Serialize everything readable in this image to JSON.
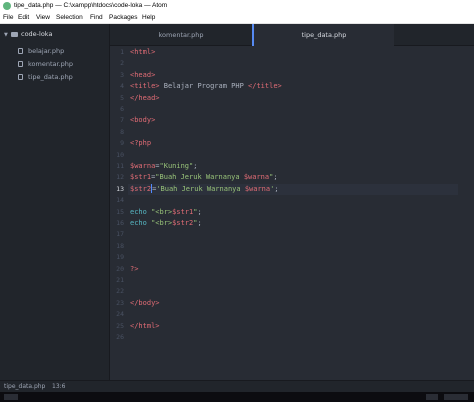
{
  "window": {
    "title": "tipe_data.php — C:\\xampp\\htdocs\\code-loka — Atom"
  },
  "menu": [
    "File",
    "Edit",
    "View",
    "Selection",
    "Find",
    "Packages",
    "Help"
  ],
  "sidebar": {
    "root": "code-loka",
    "files": [
      "belajar.php",
      "komentar.php",
      "tipe_data.php"
    ]
  },
  "tabs": [
    {
      "label": "komentar.php",
      "active": false
    },
    {
      "label": "tipe_data.php",
      "active": true
    }
  ],
  "editor": {
    "current_line": 13,
    "lines": [
      {
        "n": "1",
        "tokens": [
          {
            "t": "<html>",
            "c": "tag"
          }
        ]
      },
      {
        "n": "2",
        "tokens": []
      },
      {
        "n": "3",
        "tokens": [
          {
            "t": "<head>",
            "c": "tag"
          }
        ]
      },
      {
        "n": "4",
        "tokens": [
          {
            "t": "<title>",
            "c": "tag"
          },
          {
            "t": " Belajar Program PHP ",
            "c": "txt"
          },
          {
            "t": "</title>",
            "c": "tag"
          }
        ]
      },
      {
        "n": "5",
        "tokens": [
          {
            "t": "</head>",
            "c": "tag"
          }
        ]
      },
      {
        "n": "6",
        "tokens": []
      },
      {
        "n": "7",
        "tokens": [
          {
            "t": "<body>",
            "c": "tag"
          }
        ]
      },
      {
        "n": "8",
        "tokens": []
      },
      {
        "n": "9",
        "tokens": [
          {
            "t": "<?php",
            "c": "php"
          }
        ]
      },
      {
        "n": "10",
        "tokens": []
      },
      {
        "n": "11",
        "tokens": [
          {
            "t": "$warna",
            "c": "var"
          },
          {
            "t": "=",
            "c": "txt"
          },
          {
            "t": "\"Kuning\"",
            "c": "str"
          },
          {
            "t": ";",
            "c": "txt"
          }
        ]
      },
      {
        "n": "12",
        "tokens": [
          {
            "t": "$str1",
            "c": "var"
          },
          {
            "t": "=",
            "c": "txt"
          },
          {
            "t": "\"Buah Jeruk Warnanya ",
            "c": "str"
          },
          {
            "t": "$warna",
            "c": "var"
          },
          {
            "t": "\"",
            "c": "str"
          },
          {
            "t": ";",
            "c": "txt"
          }
        ]
      },
      {
        "n": "13",
        "tokens": [
          {
            "t": "$str2",
            "c": "var"
          },
          {
            "t": "=",
            "c": "cursor"
          },
          {
            "t": "'Buah Jeruk Warnanya ",
            "c": "str"
          },
          {
            "t": "$warna",
            "c": "var"
          },
          {
            "t": "'",
            "c": "str"
          },
          {
            "t": ";",
            "c": "txt"
          }
        ]
      },
      {
        "n": "14",
        "tokens": []
      },
      {
        "n": "15",
        "tokens": [
          {
            "t": "echo ",
            "c": "kw"
          },
          {
            "t": "\"<br>",
            "c": "str"
          },
          {
            "t": "$str1",
            "c": "var"
          },
          {
            "t": "\"",
            "c": "str"
          },
          {
            "t": ";",
            "c": "txt"
          }
        ]
      },
      {
        "n": "16",
        "tokens": [
          {
            "t": "echo ",
            "c": "kw"
          },
          {
            "t": "\"<br>",
            "c": "str"
          },
          {
            "t": "$str2",
            "c": "var"
          },
          {
            "t": "\"",
            "c": "str"
          },
          {
            "t": ";",
            "c": "txt"
          }
        ]
      },
      {
        "n": "17",
        "tokens": []
      },
      {
        "n": "18",
        "tokens": []
      },
      {
        "n": "19",
        "tokens": []
      },
      {
        "n": "20",
        "tokens": [
          {
            "t": "?>",
            "c": "php"
          }
        ]
      },
      {
        "n": "21",
        "tokens": []
      },
      {
        "n": "22",
        "tokens": []
      },
      {
        "n": "23",
        "tokens": [
          {
            "t": "</body>",
            "c": "tag"
          }
        ]
      },
      {
        "n": "24",
        "tokens": []
      },
      {
        "n": "25",
        "tokens": [
          {
            "t": "</html>",
            "c": "tag"
          }
        ]
      },
      {
        "n": "26",
        "tokens": []
      }
    ]
  },
  "status": {
    "file": "tipe_data.php",
    "position": "13:6"
  },
  "colors": {
    "accent": "#568af2",
    "editor_bg": "#282c34",
    "sidebar_bg": "#21252b"
  },
  "icons": [
    "atom-icon",
    "folder-icon",
    "file-icon",
    "chevron-down-icon"
  ]
}
